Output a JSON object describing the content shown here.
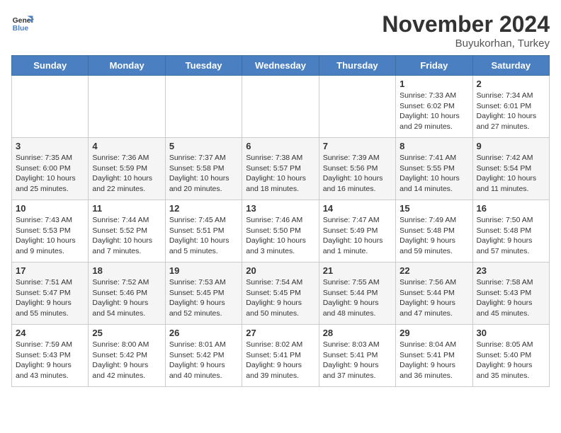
{
  "header": {
    "logo_line1": "General",
    "logo_line2": "Blue",
    "month_title": "November 2024",
    "location": "Buyukorhan, Turkey"
  },
  "days_of_week": [
    "Sunday",
    "Monday",
    "Tuesday",
    "Wednesday",
    "Thursday",
    "Friday",
    "Saturday"
  ],
  "weeks": [
    [
      {
        "day": "",
        "info": ""
      },
      {
        "day": "",
        "info": ""
      },
      {
        "day": "",
        "info": ""
      },
      {
        "day": "",
        "info": ""
      },
      {
        "day": "",
        "info": ""
      },
      {
        "day": "1",
        "info": "Sunrise: 7:33 AM\nSunset: 6:02 PM\nDaylight: 10 hours\nand 29 minutes."
      },
      {
        "day": "2",
        "info": "Sunrise: 7:34 AM\nSunset: 6:01 PM\nDaylight: 10 hours\nand 27 minutes."
      }
    ],
    [
      {
        "day": "3",
        "info": "Sunrise: 7:35 AM\nSunset: 6:00 PM\nDaylight: 10 hours\nand 25 minutes."
      },
      {
        "day": "4",
        "info": "Sunrise: 7:36 AM\nSunset: 5:59 PM\nDaylight: 10 hours\nand 22 minutes."
      },
      {
        "day": "5",
        "info": "Sunrise: 7:37 AM\nSunset: 5:58 PM\nDaylight: 10 hours\nand 20 minutes."
      },
      {
        "day": "6",
        "info": "Sunrise: 7:38 AM\nSunset: 5:57 PM\nDaylight: 10 hours\nand 18 minutes."
      },
      {
        "day": "7",
        "info": "Sunrise: 7:39 AM\nSunset: 5:56 PM\nDaylight: 10 hours\nand 16 minutes."
      },
      {
        "day": "8",
        "info": "Sunrise: 7:41 AM\nSunset: 5:55 PM\nDaylight: 10 hours\nand 14 minutes."
      },
      {
        "day": "9",
        "info": "Sunrise: 7:42 AM\nSunset: 5:54 PM\nDaylight: 10 hours\nand 11 minutes."
      }
    ],
    [
      {
        "day": "10",
        "info": "Sunrise: 7:43 AM\nSunset: 5:53 PM\nDaylight: 10 hours\nand 9 minutes."
      },
      {
        "day": "11",
        "info": "Sunrise: 7:44 AM\nSunset: 5:52 PM\nDaylight: 10 hours\nand 7 minutes."
      },
      {
        "day": "12",
        "info": "Sunrise: 7:45 AM\nSunset: 5:51 PM\nDaylight: 10 hours\nand 5 minutes."
      },
      {
        "day": "13",
        "info": "Sunrise: 7:46 AM\nSunset: 5:50 PM\nDaylight: 10 hours\nand 3 minutes."
      },
      {
        "day": "14",
        "info": "Sunrise: 7:47 AM\nSunset: 5:49 PM\nDaylight: 10 hours\nand 1 minute."
      },
      {
        "day": "15",
        "info": "Sunrise: 7:49 AM\nSunset: 5:48 PM\nDaylight: 9 hours\nand 59 minutes."
      },
      {
        "day": "16",
        "info": "Sunrise: 7:50 AM\nSunset: 5:48 PM\nDaylight: 9 hours\nand 57 minutes."
      }
    ],
    [
      {
        "day": "17",
        "info": "Sunrise: 7:51 AM\nSunset: 5:47 PM\nDaylight: 9 hours\nand 55 minutes."
      },
      {
        "day": "18",
        "info": "Sunrise: 7:52 AM\nSunset: 5:46 PM\nDaylight: 9 hours\nand 54 minutes."
      },
      {
        "day": "19",
        "info": "Sunrise: 7:53 AM\nSunset: 5:45 PM\nDaylight: 9 hours\nand 52 minutes."
      },
      {
        "day": "20",
        "info": "Sunrise: 7:54 AM\nSunset: 5:45 PM\nDaylight: 9 hours\nand 50 minutes."
      },
      {
        "day": "21",
        "info": "Sunrise: 7:55 AM\nSunset: 5:44 PM\nDaylight: 9 hours\nand 48 minutes."
      },
      {
        "day": "22",
        "info": "Sunrise: 7:56 AM\nSunset: 5:44 PM\nDaylight: 9 hours\nand 47 minutes."
      },
      {
        "day": "23",
        "info": "Sunrise: 7:58 AM\nSunset: 5:43 PM\nDaylight: 9 hours\nand 45 minutes."
      }
    ],
    [
      {
        "day": "24",
        "info": "Sunrise: 7:59 AM\nSunset: 5:43 PM\nDaylight: 9 hours\nand 43 minutes."
      },
      {
        "day": "25",
        "info": "Sunrise: 8:00 AM\nSunset: 5:42 PM\nDaylight: 9 hours\nand 42 minutes."
      },
      {
        "day": "26",
        "info": "Sunrise: 8:01 AM\nSunset: 5:42 PM\nDaylight: 9 hours\nand 40 minutes."
      },
      {
        "day": "27",
        "info": "Sunrise: 8:02 AM\nSunset: 5:41 PM\nDaylight: 9 hours\nand 39 minutes."
      },
      {
        "day": "28",
        "info": "Sunrise: 8:03 AM\nSunset: 5:41 PM\nDaylight: 9 hours\nand 37 minutes."
      },
      {
        "day": "29",
        "info": "Sunrise: 8:04 AM\nSunset: 5:41 PM\nDaylight: 9 hours\nand 36 minutes."
      },
      {
        "day": "30",
        "info": "Sunrise: 8:05 AM\nSunset: 5:40 PM\nDaylight: 9 hours\nand 35 minutes."
      }
    ]
  ]
}
